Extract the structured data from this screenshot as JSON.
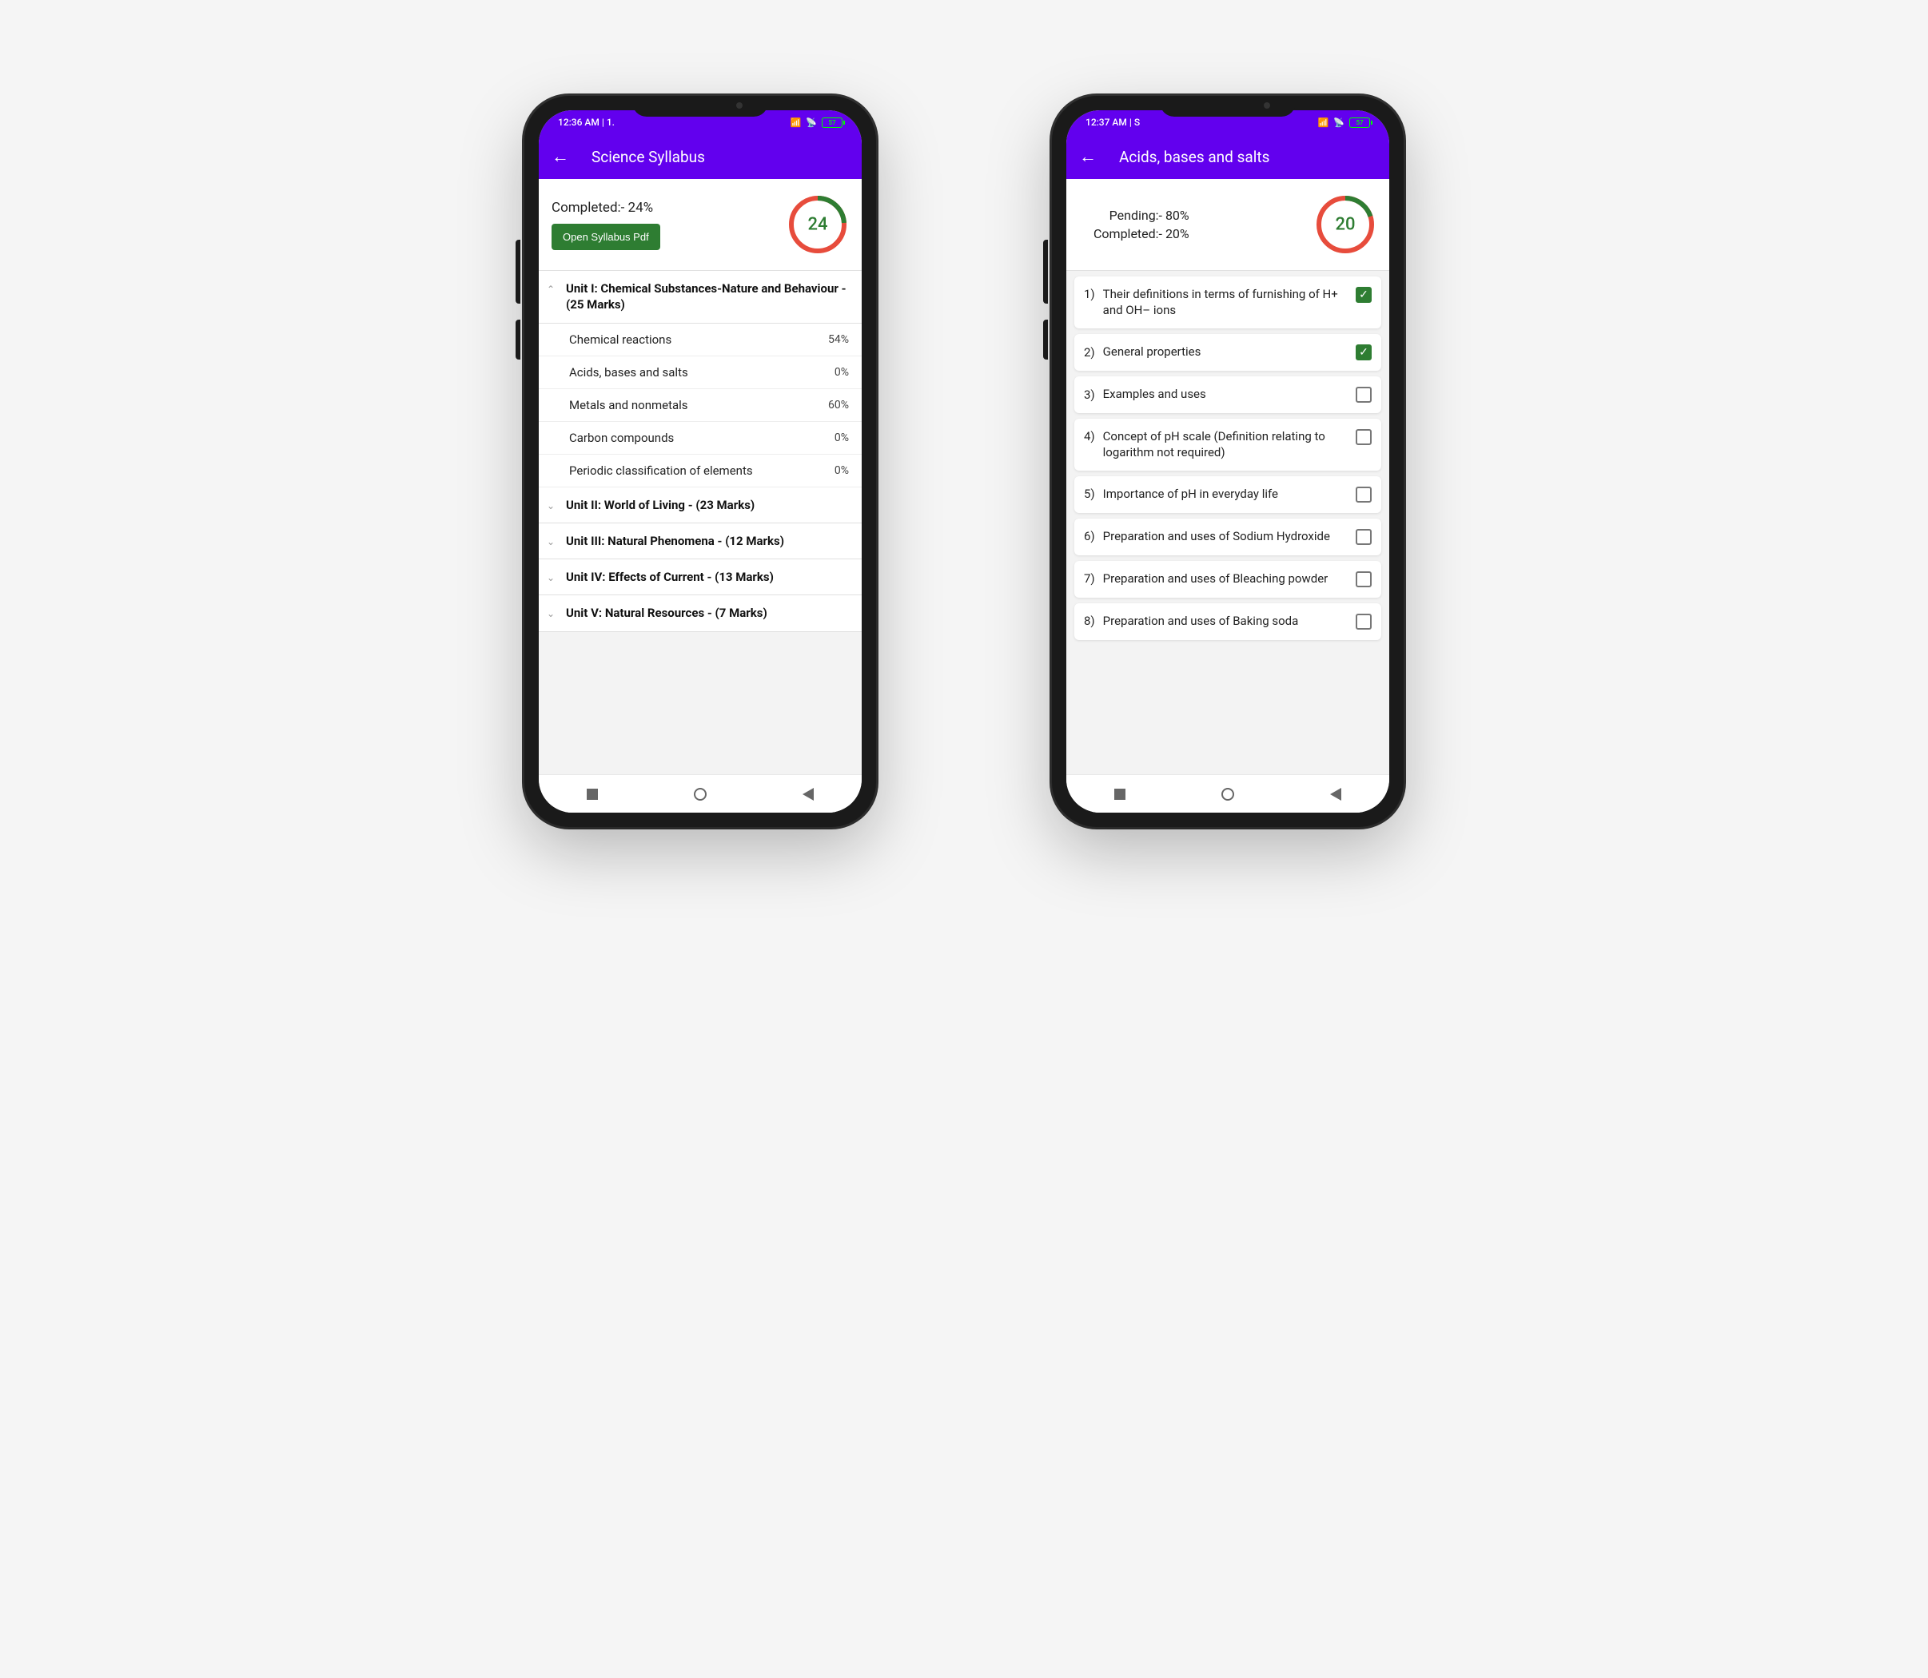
{
  "phone1": {
    "status": {
      "time": "12:36 AM | 1.",
      "battery": "57"
    },
    "appbar": {
      "title": "Science Syllabus"
    },
    "summary": {
      "completed": "Completed:- 24%",
      "button": "Open Syllabus Pdf",
      "ring_value": "24",
      "ring_pct": 24
    },
    "units": [
      {
        "title": "Unit I: Chemical Substances-Nature and Behaviour - (25 Marks)",
        "expanded": true,
        "subs": [
          {
            "name": "Chemical reactions",
            "pct": "54%"
          },
          {
            "name": "Acids, bases and salts",
            "pct": "0%"
          },
          {
            "name": "Metals and nonmetals",
            "pct": "60%"
          },
          {
            "name": "Carbon compounds",
            "pct": "0%"
          },
          {
            "name": "Periodic classification of elements",
            "pct": "0%"
          }
        ]
      },
      {
        "title": "Unit II: World of Living - (23 Marks)",
        "expanded": false
      },
      {
        "title": "Unit III: Natural Phenomena - (12 Marks)",
        "expanded": false
      },
      {
        "title": "Unit IV: Effects of Current - (13 Marks)",
        "expanded": false
      },
      {
        "title": "Unit V: Natural Resources - (7 Marks)",
        "expanded": false
      }
    ]
  },
  "phone2": {
    "status": {
      "time": "12:37 AM | S",
      "battery": "57"
    },
    "appbar": {
      "title": "Acids, bases and salts"
    },
    "summary": {
      "pending": "Pending:- 80%",
      "completed": "Completed:- 20%",
      "ring_value": "20",
      "ring_pct": 20
    },
    "topics": [
      {
        "num": "1)",
        "text": "Their definitions in terms of furnishing of H+ and OH– ions",
        "checked": true
      },
      {
        "num": "2)",
        "text": "General properties",
        "checked": true
      },
      {
        "num": "3)",
        "text": "Examples and uses",
        "checked": false
      },
      {
        "num": "4)",
        "text": "Concept of pH scale (Definition relating to logarithm not required)",
        "checked": false
      },
      {
        "num": "5)",
        "text": "Importance of pH in everyday life",
        "checked": false
      },
      {
        "num": "6)",
        "text": "Preparation and uses of Sodium Hydroxide",
        "checked": false
      },
      {
        "num": "7)",
        "text": "Preparation and uses of Bleaching powder",
        "checked": false
      },
      {
        "num": "8)",
        "text": "Preparation and uses of Baking soda",
        "checked": false
      }
    ]
  }
}
